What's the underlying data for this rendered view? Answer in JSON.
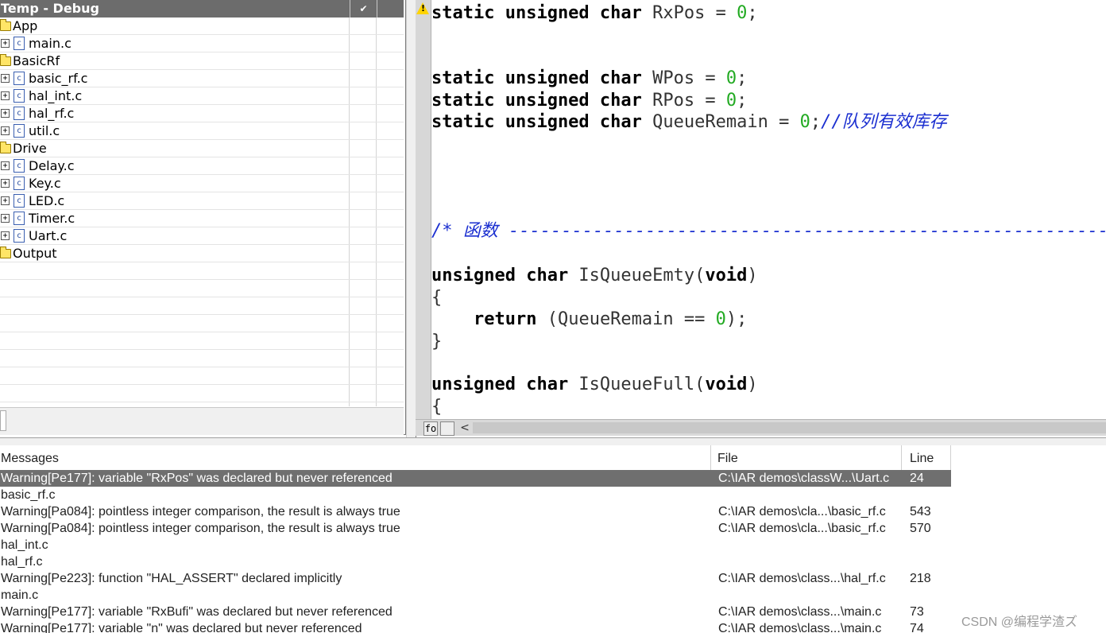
{
  "workspace": {
    "title": "Temp - Debug",
    "check_glyph": "✔",
    "items": [
      {
        "type": "folder",
        "label": "App"
      },
      {
        "type": "file",
        "label": "main.c"
      },
      {
        "type": "folder",
        "label": "BasicRf"
      },
      {
        "type": "file",
        "label": "basic_rf.c"
      },
      {
        "type": "file",
        "label": "hal_int.c"
      },
      {
        "type": "file",
        "label": "hal_rf.c"
      },
      {
        "type": "file",
        "label": "util.c"
      },
      {
        "type": "folder",
        "label": "Drive"
      },
      {
        "type": "file",
        "label": "Delay.c"
      },
      {
        "type": "file",
        "label": "Key.c"
      },
      {
        "type": "file",
        "label": "LED.c"
      },
      {
        "type": "file",
        "label": "Timer.c"
      },
      {
        "type": "file",
        "label": "Uart.c"
      },
      {
        "type": "folder",
        "label": "Output"
      }
    ],
    "expand_glyph": "+",
    "file_glyph": "c"
  },
  "editor": {
    "lines": [
      {
        "kw": "static unsigned char",
        "rest": " RxPos = ",
        "num": "0",
        "end": ";"
      },
      {
        "kw": "static unsigned char",
        "rest": " WPos = ",
        "num": "0",
        "end": ";"
      },
      {
        "kw": "static unsigned char",
        "rest": " RPos = ",
        "num": "0",
        "end": ";"
      },
      {
        "kw": "static unsigned char",
        "rest": " QueueRemain = ",
        "num": "0",
        "end": ";",
        "comment": "//队列有效库存"
      },
      {
        "comment": "/* 函数 ------------------------------------------------------------"
      },
      {
        "kw": "unsigned char",
        "rest": " IsQueueEmty(",
        "kw2": "void",
        "end": ")"
      },
      {
        "text": "{"
      },
      {
        "indent": "    ",
        "kw": "return",
        "rest": " (QueueRemain == ",
        "num": "0",
        "end": ");"
      },
      {
        "text": "}"
      },
      {
        "kw": "unsigned char",
        "rest": " IsQueueFull(",
        "kw2": "void",
        "end": ")"
      },
      {
        "text": "{"
      }
    ],
    "tab_fo": "fo",
    "scroll_left": "<",
    "warning_mark": "!"
  },
  "messages": {
    "headers": {
      "messages": "Messages",
      "file": "File",
      "line": "Line"
    },
    "rows": [
      {
        "msg": "Warning[Pe177]: variable \"RxPos\" was declared but never referenced",
        "file": "C:\\IAR demos\\classW...\\Uart.c",
        "line": "24",
        "selected": true
      },
      {
        "msg": "basic_rf.c",
        "file": "",
        "line": ""
      },
      {
        "msg": "Warning[Pa084]: pointless integer comparison, the result is always true",
        "file": "C:\\IAR demos\\cla...\\basic_rf.c",
        "line": "543"
      },
      {
        "msg": "Warning[Pa084]: pointless integer comparison, the result is always true",
        "file": "C:\\IAR demos\\cla...\\basic_rf.c",
        "line": "570"
      },
      {
        "msg": "hal_int.c",
        "file": "",
        "line": ""
      },
      {
        "msg": "hal_rf.c",
        "file": "",
        "line": ""
      },
      {
        "msg": "Warning[Pe223]: function \"HAL_ASSERT\" declared implicitly",
        "file": "C:\\IAR demos\\class...\\hal_rf.c",
        "line": "218"
      },
      {
        "msg": "main.c",
        "file": "",
        "line": ""
      },
      {
        "msg": "Warning[Pe177]: variable \"RxBufi\" was declared but never referenced",
        "file": "C:\\IAR demos\\class...\\main.c",
        "line": "73"
      },
      {
        "msg": "Warning[Pe177]: variable \"n\" was declared but never referenced",
        "file": "C:\\IAR demos\\class...\\main.c",
        "line": "74"
      }
    ]
  },
  "watermark": "CSDN @编程学渣ズ"
}
